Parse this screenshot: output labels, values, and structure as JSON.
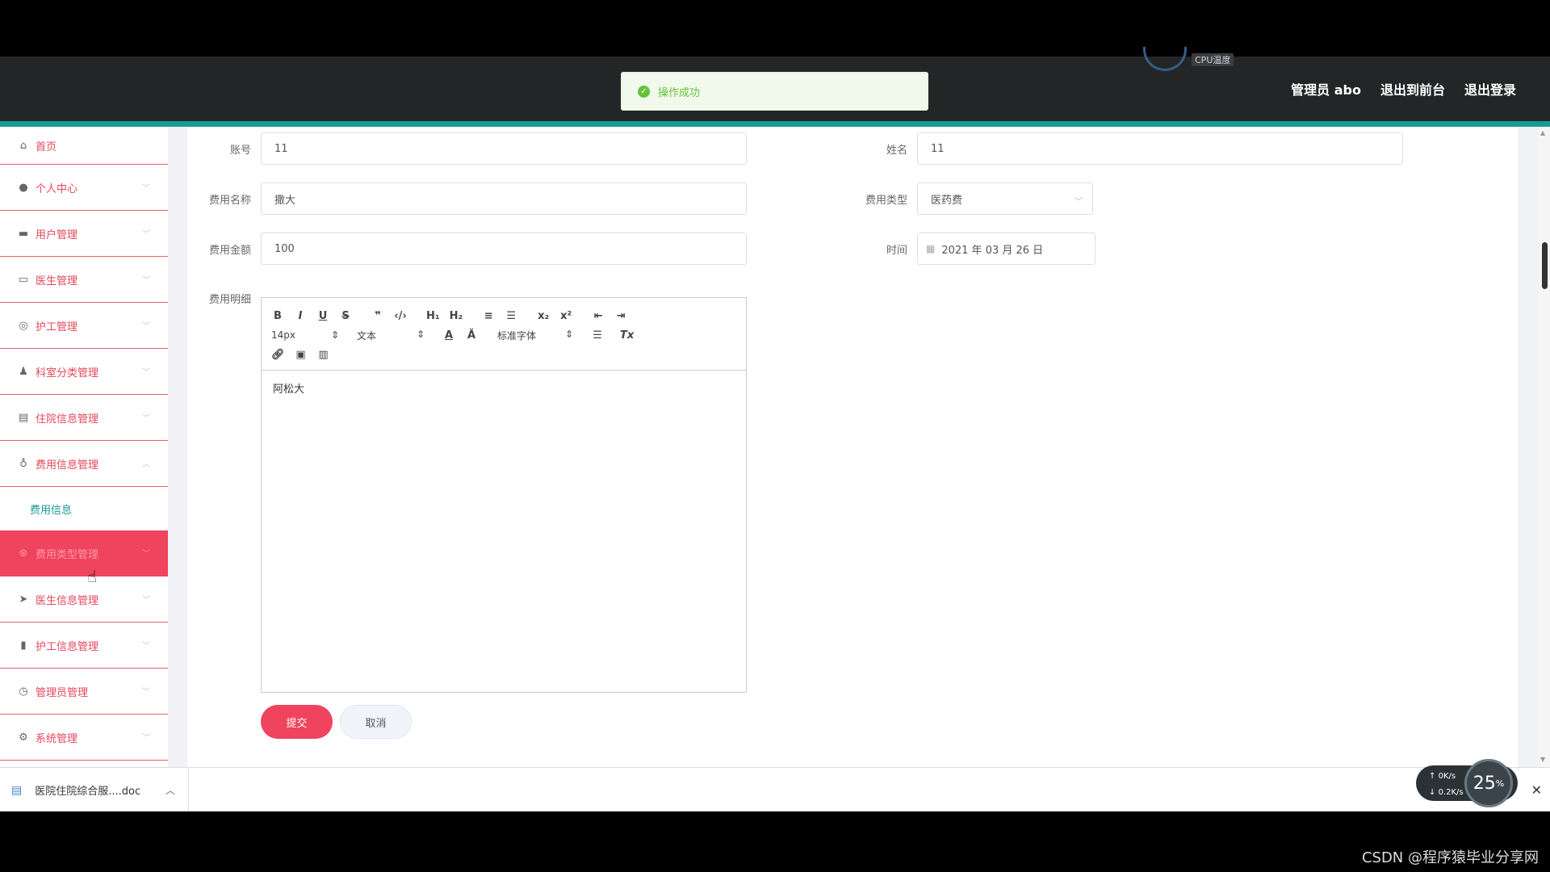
{
  "header": {
    "cpu_label": "CPU温度",
    "links": [
      "管理员 abo",
      "退出到前台",
      "退出登录"
    ]
  },
  "toast": {
    "message": "操作成功"
  },
  "sidebar": {
    "items": [
      {
        "label": "首页",
        "icon": "home-icon"
      },
      {
        "label": "个人中心",
        "icon": "user-icon"
      },
      {
        "label": "用户管理",
        "icon": "ticket-icon"
      },
      {
        "label": "医生管理",
        "icon": "monitor-icon"
      },
      {
        "label": "护工管理",
        "icon": "compass-icon"
      },
      {
        "label": "科室分类管理",
        "icon": "person-icon"
      },
      {
        "label": "住院信息管理",
        "icon": "chat-icon"
      },
      {
        "label": "费用信息管理",
        "icon": "mic-icon"
      },
      {
        "label": "费用信息",
        "icon": ""
      },
      {
        "label": "费用类型管理",
        "icon": "basketball-icon"
      },
      {
        "label": "医生信息管理",
        "icon": "send-icon"
      },
      {
        "label": "护工信息管理",
        "icon": "bar-chart-icon"
      },
      {
        "label": "管理员管理",
        "icon": "clock-icon"
      },
      {
        "label": "系统管理",
        "icon": "settings-icon"
      }
    ]
  },
  "form": {
    "account_label": "账号",
    "account_value": "11",
    "name_label": "姓名",
    "name_value": "11",
    "fee_name_label": "费用名称",
    "fee_name_value": "撒大",
    "fee_type_label": "费用类型",
    "fee_type_value": "医药费",
    "fee_amount_label": "费用金额",
    "fee_amount_value": "100",
    "time_label": "时间",
    "time_value": "2021 年 03 月 26 日",
    "fee_detail_label": "费用明细",
    "editor": {
      "font_size": "14px",
      "format": "文本",
      "font_family": "标准字体",
      "content": "阿松大"
    },
    "submit_label": "提交",
    "cancel_label": "取消"
  },
  "download": {
    "filename": "医院住院综合服....doc"
  },
  "net": {
    "up": "0K/s",
    "down": "0.2K/s",
    "percent": "25",
    "percent_unit": "%"
  },
  "watermark": "CSDN @程序猿毕业分享网"
}
